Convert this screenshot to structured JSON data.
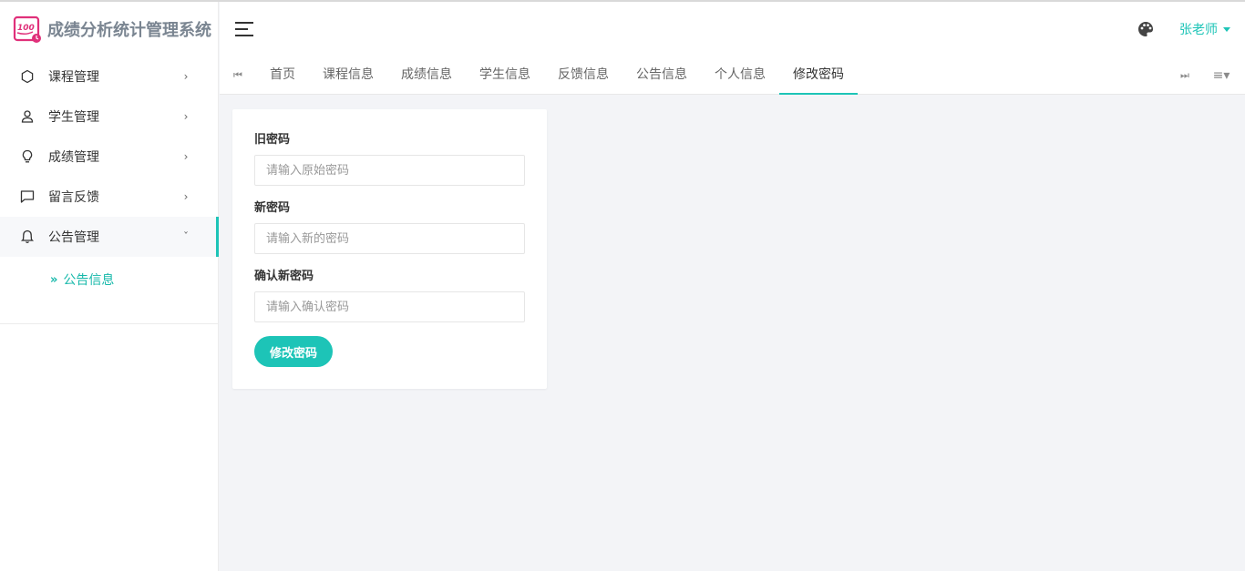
{
  "app": {
    "title": "成绩分析统计管理系统",
    "accent": "#1dc4b7"
  },
  "sidebar": {
    "items": [
      {
        "label": "课程管理",
        "icon": "circle-icon",
        "expanded": false
      },
      {
        "label": "学生管理",
        "icon": "user-icon",
        "expanded": false
      },
      {
        "label": "成绩管理",
        "icon": "bulb-icon",
        "expanded": false
      },
      {
        "label": "留言反馈",
        "icon": "chat-icon",
        "expanded": false
      },
      {
        "label": "公告管理",
        "icon": "bell-icon",
        "expanded": true
      }
    ],
    "subitems": [
      {
        "label": "公告信息"
      }
    ]
  },
  "header": {
    "user_name": "张老师"
  },
  "tabs": [
    {
      "label": "首页"
    },
    {
      "label": "课程信息"
    },
    {
      "label": "成绩信息"
    },
    {
      "label": "学生信息"
    },
    {
      "label": "反馈信息"
    },
    {
      "label": "公告信息"
    },
    {
      "label": "个人信息"
    },
    {
      "label": "修改密码",
      "active": true
    }
  ],
  "form": {
    "old_password": {
      "label": "旧密码",
      "placeholder": "请输入原始密码"
    },
    "new_password": {
      "label": "新密码",
      "placeholder": "请输入新的密码"
    },
    "confirm_password": {
      "label": "确认新密码",
      "placeholder": "请输入确认密码"
    },
    "submit_label": "修改密码"
  }
}
